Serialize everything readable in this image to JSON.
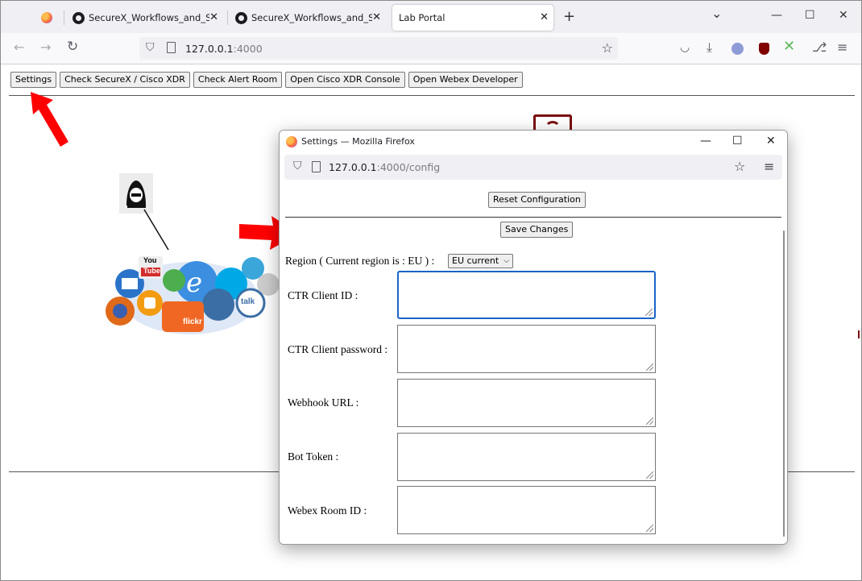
{
  "browser": {
    "tabs": [
      {
        "title": "SecureX_Workflows_and_Stuffs",
        "close": "✕"
      },
      {
        "title": "SecureX_Workflows_and_Stuffs",
        "close": "✕"
      },
      {
        "title": "Lab Portal",
        "close": "✕"
      }
    ],
    "new_tab": "+",
    "tab_list": "⌄",
    "window_controls": {
      "minimize": "—",
      "maximize": "☐",
      "close": "✕"
    },
    "url_host": "127.0.0.1",
    "url_port": ":4000",
    "icons": [
      "firefox-icon",
      "github-icon",
      "back-icon",
      "forward-icon",
      "reload-icon",
      "shield-icon",
      "page-icon",
      "star-icon",
      "pocket-icon",
      "download-icon",
      "account-icon",
      "ublock-icon",
      "extension-icon",
      "puzzle-icon",
      "menu-icon"
    ]
  },
  "page": {
    "buttons": [
      "Settings",
      "Check SecureX / Cisco XDR",
      "Check Alert Room",
      "Open Cisco XDR Console",
      "Open Webex Developer"
    ],
    "illustration_words": {
      "you": "You",
      "tube": "Tube",
      "flickr": "flickr",
      "talk": "talk"
    }
  },
  "popup": {
    "title": "Settings — Mozilla Firefox",
    "url_host": "127.0.0.1",
    "url_rest": ":4000/config",
    "reset_label": "Reset Configuration",
    "save_label": "Save Changes",
    "region_label": "Region ( Current region is : EU ) :",
    "region_select": "EU current",
    "fields": [
      {
        "label": "CTR Client ID :",
        "value": ""
      },
      {
        "label": "CTR Client password :",
        "value": ""
      },
      {
        "label": "Webhook URL :",
        "value": ""
      },
      {
        "label": "Bot Token :",
        "value": ""
      },
      {
        "label": "Webex Room ID :",
        "value": ""
      }
    ]
  },
  "colors": {
    "arrow": "#ff0000",
    "focus": "#1a64c8",
    "tabstrip": "#f0f0f4"
  }
}
